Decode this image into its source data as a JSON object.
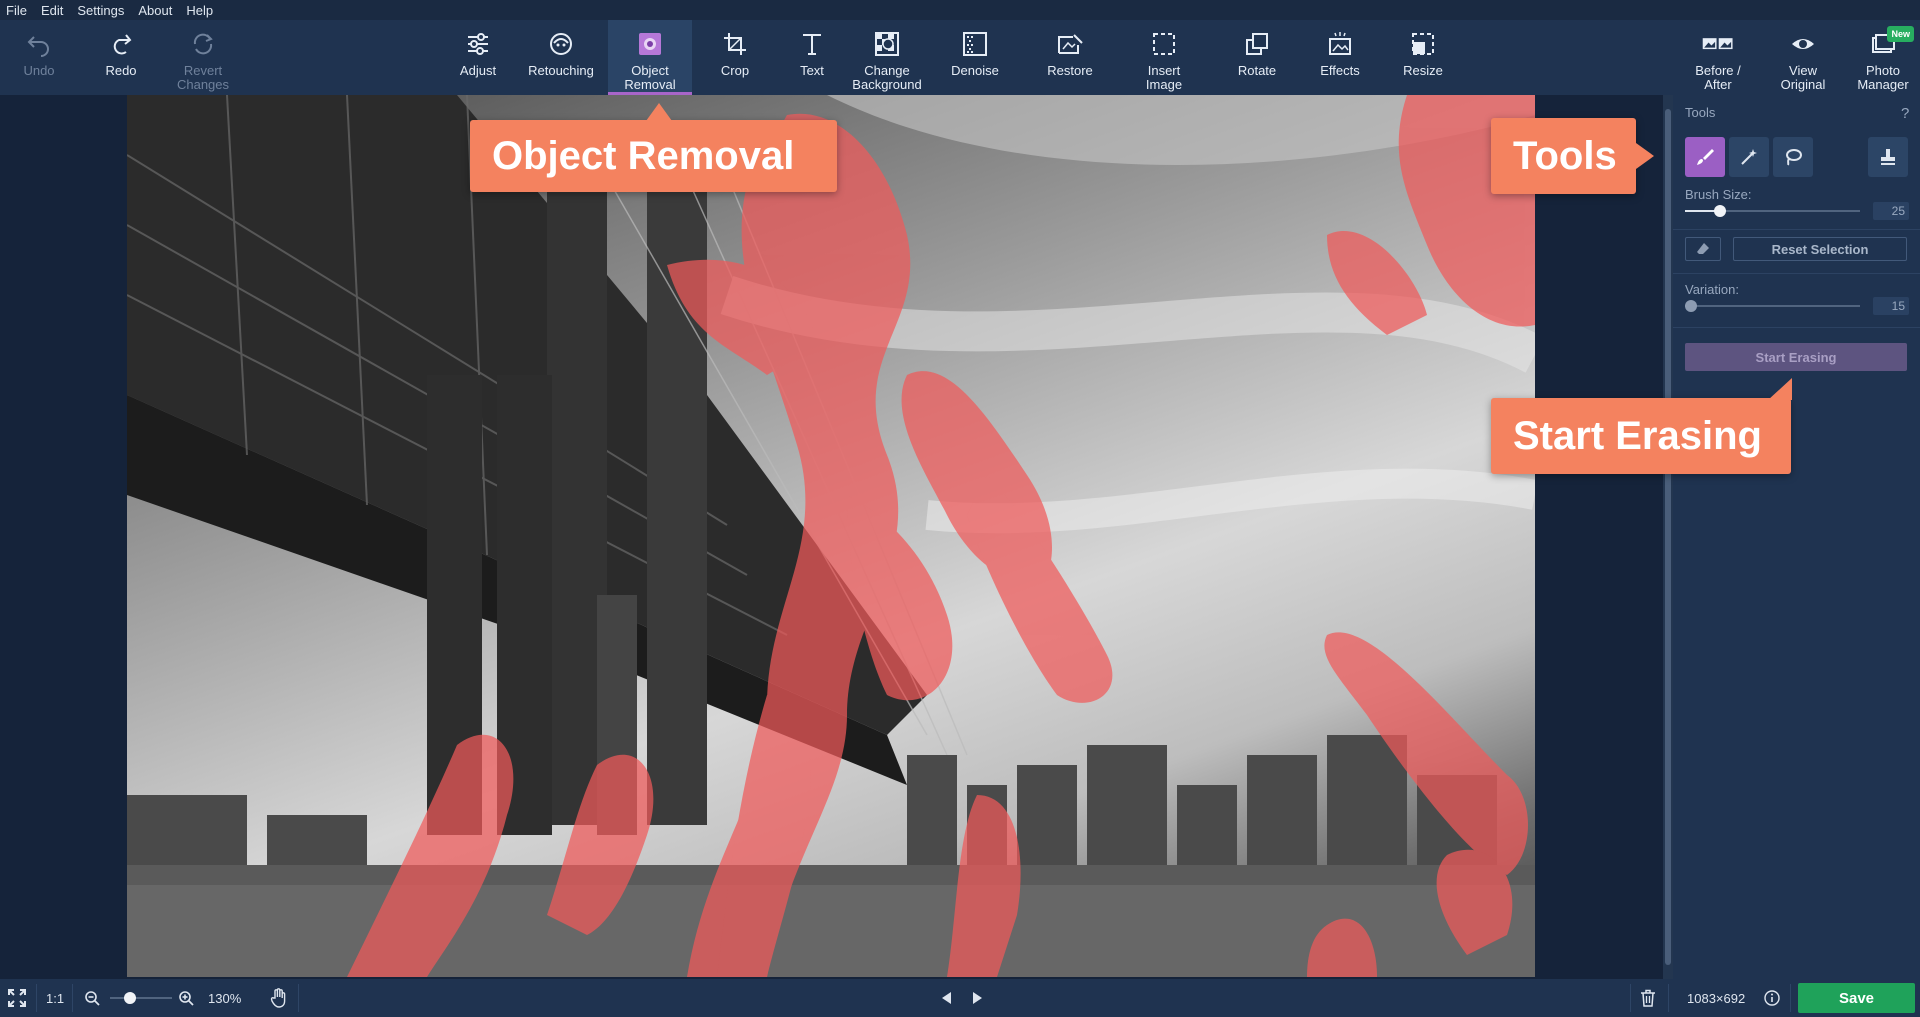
{
  "menu": [
    "File",
    "Edit",
    "Settings",
    "About",
    "Help"
  ],
  "toolbar": {
    "undo": "Undo",
    "redo": "Redo",
    "revert": "Revert\nChanges",
    "adjust": "Adjust",
    "retouching": "Retouching",
    "object_removal": "Object\nRemoval",
    "crop": "Crop",
    "text": "Text",
    "change_background": "Change\nBackground",
    "denoise": "Denoise",
    "restore": "Restore",
    "insert_image": "Insert\nImage",
    "rotate": "Rotate",
    "effects": "Effects",
    "resize": "Resize",
    "before_after": "Before /\nAfter",
    "view_original": "View\nOriginal",
    "photo_manager": "Photo\nManager",
    "new_badge": "New"
  },
  "callouts": {
    "object_removal": "Object Removal",
    "tools": "Tools",
    "start_erasing": "Start Erasing"
  },
  "panel": {
    "tools_label": "Tools",
    "help": "?",
    "brush_size_label": "Brush Size:",
    "brush_size_value": "25",
    "brush_size_fraction": 0.18,
    "reset_selection": "Reset Selection",
    "variation_label": "Variation:",
    "variation_value": "15",
    "variation_fraction": 0.0,
    "start_erasing": "Start Erasing"
  },
  "bottom": {
    "ratio": "1:1",
    "zoom": "130%",
    "zoom_fraction": 0.28,
    "dimensions": "1083×692",
    "save": "Save"
  },
  "colors": {
    "accent_purple": "#9b5fc4",
    "callout_orange": "#f4825f",
    "save_green": "#1fa25a",
    "mask_red": "#f05a5a"
  }
}
